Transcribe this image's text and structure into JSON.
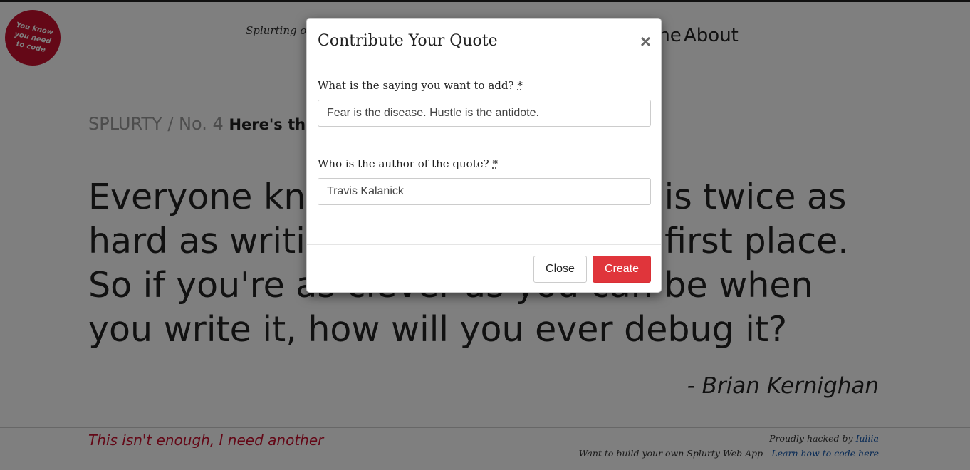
{
  "logo": {
    "lines": [
      "You know",
      "you need",
      "to code"
    ]
  },
  "header": {
    "tagline": "Splurting out quotes",
    "nav": {
      "home": "Home",
      "about": "About"
    }
  },
  "breadcrumb": {
    "site": "SPLURTY / No. 4",
    "title": "Here's the quote"
  },
  "quote": {
    "text": "Everyone knows that debugging is twice as hard as writing a program in the first place. So if you're as clever as you can be when you write it, how will you ever debug it?",
    "author": "- Brian Kernighan"
  },
  "footer": {
    "another": "This isn't enough, I need another",
    "hacked_prefix": "Proudly hacked by",
    "hacked_by": "Iuliia",
    "build_prefix": "Want to build your own Splurty Web App -",
    "build_link": "Learn how to code here"
  },
  "modal": {
    "title": "Contribute Your Quote",
    "close_x": "×",
    "saying_label": "What is the saying you want to add?",
    "saying_value": "Fear is the disease. Hustle is the antidote.",
    "author_label": "Who is the author of the quote?",
    "author_value": "Travis Kalanick",
    "required_mark": "*",
    "close_button": "Close",
    "create_button": "Create"
  }
}
